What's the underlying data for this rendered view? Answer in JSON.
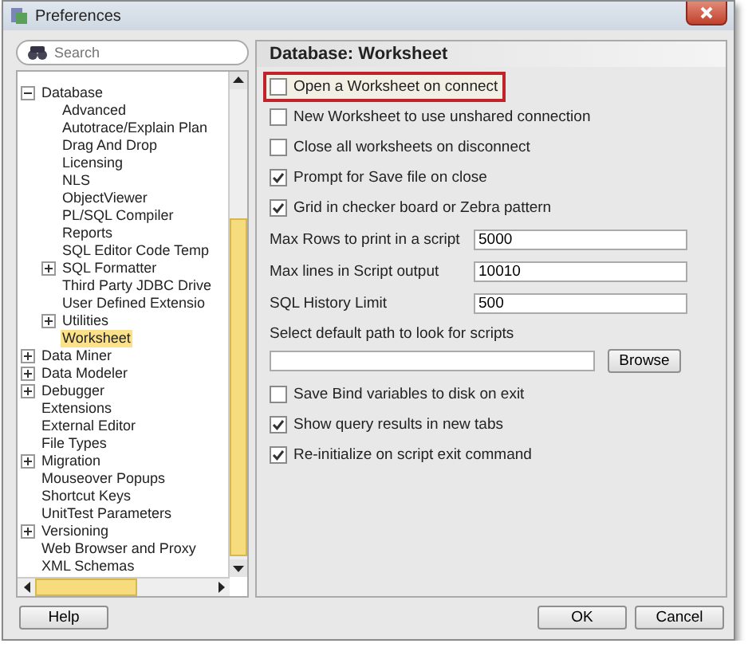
{
  "window": {
    "title": "Preferences"
  },
  "search": {
    "placeholder": "Search"
  },
  "tree": [
    {
      "label": "Database",
      "expanded": true,
      "selected": false,
      "children": [
        {
          "label": "Advanced",
          "selected": false
        },
        {
          "label": "Autotrace/Explain Plan",
          "selected": false
        },
        {
          "label": "Drag And Drop",
          "selected": false
        },
        {
          "label": "Licensing",
          "selected": false
        },
        {
          "label": "NLS",
          "selected": false
        },
        {
          "label": "ObjectViewer",
          "selected": false
        },
        {
          "label": "PL/SQL Compiler",
          "selected": false
        },
        {
          "label": "Reports",
          "selected": false
        },
        {
          "label": "SQL Editor Code Temp",
          "selected": false
        },
        {
          "label": "SQL Formatter",
          "expanded": false,
          "selected": false
        },
        {
          "label": "Third Party JDBC Drive",
          "selected": false
        },
        {
          "label": "User Defined Extensio",
          "selected": false
        },
        {
          "label": "Utilities",
          "expanded": false,
          "selected": false
        },
        {
          "label": "Worksheet",
          "selected": true
        }
      ]
    },
    {
      "label": "Data Miner",
      "expanded": false,
      "selected": false
    },
    {
      "label": "Data Modeler",
      "expanded": false,
      "selected": false
    },
    {
      "label": "Debugger",
      "expanded": false,
      "selected": false
    },
    {
      "label": "Extensions",
      "selected": false
    },
    {
      "label": "External Editor",
      "selected": false
    },
    {
      "label": "File Types",
      "selected": false
    },
    {
      "label": "Migration",
      "expanded": false,
      "selected": false
    },
    {
      "label": "Mouseover Popups",
      "selected": false
    },
    {
      "label": "Shortcut Keys",
      "selected": false
    },
    {
      "label": "UnitTest Parameters",
      "selected": false
    },
    {
      "label": "Versioning",
      "expanded": false,
      "selected": false
    },
    {
      "label": "Web Browser and Proxy",
      "selected": false
    },
    {
      "label": "XML Schemas",
      "selected": false
    }
  ],
  "panel": {
    "title": "Database: Worksheet",
    "settings": [
      {
        "kind": "checkbox",
        "label": "Open a Worksheet on connect",
        "checked": false,
        "highlighted": true
      },
      {
        "kind": "checkbox",
        "label": "New Worksheet to use unshared connection",
        "checked": false,
        "highlighted": false
      },
      {
        "kind": "checkbox",
        "label": "Close all worksheets on disconnect",
        "checked": false,
        "highlighted": false
      },
      {
        "kind": "checkbox",
        "label": "Prompt for Save file on close",
        "checked": true,
        "highlighted": false
      },
      {
        "kind": "checkbox",
        "label": "Grid in checker board or Zebra pattern",
        "checked": true,
        "highlighted": false
      },
      {
        "kind": "field",
        "label": "Max Rows to print in a script",
        "value": "5000"
      },
      {
        "kind": "field",
        "label": "Max lines in Script output",
        "value": "10010"
      },
      {
        "kind": "field",
        "label": "SQL History Limit",
        "value": "500"
      },
      {
        "kind": "caption",
        "label": "Select default path to look for scripts"
      },
      {
        "kind": "browse",
        "button": "Browse"
      },
      {
        "kind": "checkbox",
        "label": "Save Bind variables to disk on exit",
        "checked": false,
        "highlighted": false
      },
      {
        "kind": "checkbox",
        "label": "Show query results in new tabs",
        "checked": true,
        "highlighted": false
      },
      {
        "kind": "checkbox",
        "label": "Re-initialize on script exit command",
        "checked": true,
        "highlighted": false
      }
    ]
  },
  "footer": {
    "help": "Help",
    "actions": [
      "OK",
      "Cancel"
    ]
  }
}
